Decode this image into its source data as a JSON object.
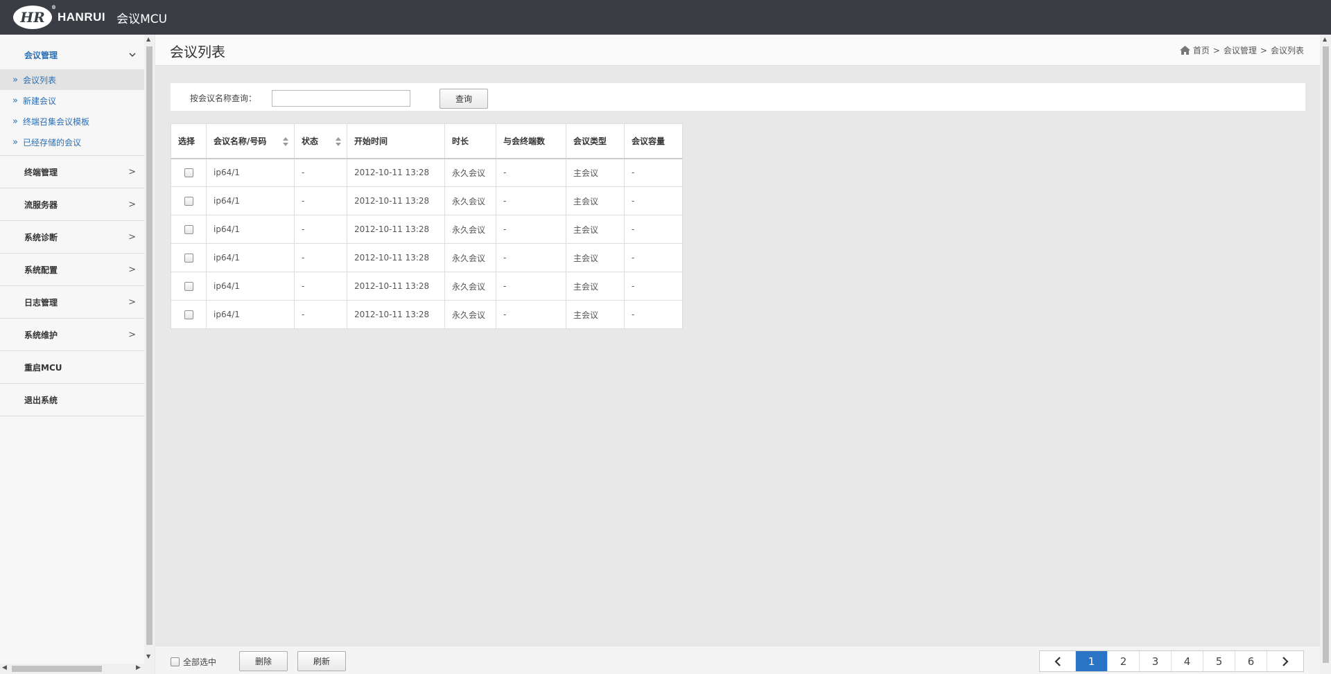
{
  "header": {
    "logo_text": "HR",
    "brand": "HANRUI",
    "app_title": "会议MCU"
  },
  "sidebar": {
    "groups": [
      {
        "label": "会议管理",
        "chevron": "∨",
        "open": true,
        "items": [
          {
            "label": "会议列表"
          },
          {
            "label": "新建会议"
          },
          {
            "label": "终端召集会议模板"
          },
          {
            "label": "已经存储的会议"
          }
        ]
      },
      {
        "label": "终端管理",
        "chevron": ">"
      },
      {
        "label": "流服务器",
        "chevron": ">"
      },
      {
        "label": "系统诊断",
        "chevron": ">"
      },
      {
        "label": "系统配置",
        "chevron": ">"
      },
      {
        "label": "日志管理",
        "chevron": ">"
      },
      {
        "label": "系统维护",
        "chevron": ">"
      },
      {
        "label": "重启MCU",
        "chevron": ""
      },
      {
        "label": "退出系统",
        "chevron": ""
      }
    ],
    "bullet": "»"
  },
  "page": {
    "title": "会议列表",
    "breadcrumb": [
      "首页",
      "会议管理",
      "会议列表"
    ],
    "breadcrumb_sep": ">"
  },
  "search": {
    "label": "按会议名称查询：",
    "value": "",
    "placeholder": "",
    "button": "查询"
  },
  "table": {
    "columns": [
      "选择",
      "会议名称/号码",
      "状态",
      "开始时间",
      "时长",
      "与会终端数",
      "会议类型",
      "会议容量"
    ],
    "rows": [
      [
        "",
        "ip64/1",
        "-",
        "2012-10-11 13:28",
        "永久会议",
        "-",
        "主会议",
        "-"
      ],
      [
        "",
        "ip64/1",
        "-",
        "2012-10-11 13:28",
        "永久会议",
        "-",
        "主会议",
        "-"
      ],
      [
        "",
        "ip64/1",
        "-",
        "2012-10-11 13:28",
        "永久会议",
        "-",
        "主会议",
        "-"
      ],
      [
        "",
        "ip64/1",
        "-",
        "2012-10-11 13:28",
        "永久会议",
        "-",
        "主会议",
        "-"
      ],
      [
        "",
        "ip64/1",
        "-",
        "2012-10-11 13:28",
        "永久会议",
        "-",
        "主会议",
        "-"
      ],
      [
        "",
        "ip64/1",
        "-",
        "2012-10-11 13:28",
        "永久会议",
        "-",
        "主会议",
        "-"
      ]
    ]
  },
  "footer": {
    "select_all": "全部选中",
    "delete": "删除",
    "refresh": "刷新"
  },
  "pagination": {
    "prev": "‹",
    "next": "›",
    "pages": [
      "1",
      "2",
      "3",
      "4",
      "5",
      "6"
    ],
    "current": "1"
  },
  "colors": {
    "header_bg": "#3a3d44",
    "accent": "#2a73c5",
    "link": "#2a6fb5"
  }
}
